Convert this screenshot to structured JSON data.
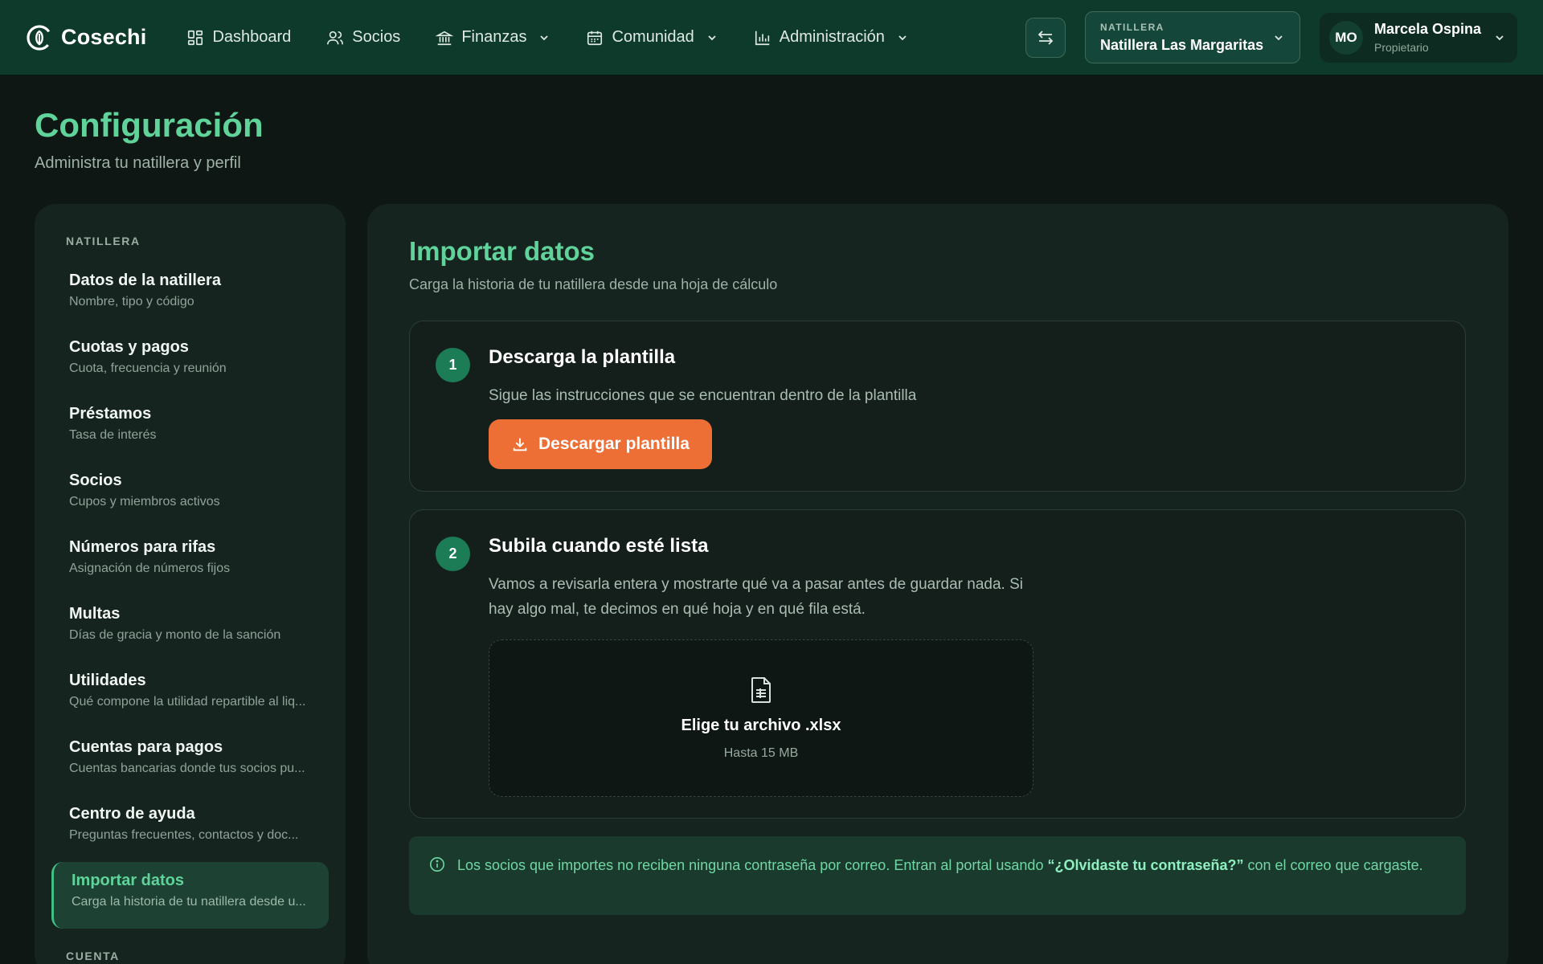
{
  "brand": {
    "name": "Cosechi"
  },
  "nav": {
    "items": [
      {
        "label": "Dashboard",
        "icon": "dashboard-icon"
      },
      {
        "label": "Socios",
        "icon": "users-icon"
      },
      {
        "label": "Finanzas",
        "icon": "bank-icon"
      },
      {
        "label": "Comunidad",
        "icon": "calendar-icon"
      },
      {
        "label": "Administración",
        "icon": "chart-icon"
      }
    ]
  },
  "org": {
    "label": "NATILLERA",
    "name": "Natillera Las Margaritas"
  },
  "user": {
    "initials": "MO",
    "name": "Marcela Ospina",
    "role": "Propietario"
  },
  "page": {
    "title": "Configuración",
    "subtitle": "Administra tu natillera y perfil"
  },
  "sidebar": {
    "section1": "NATILLERA",
    "section2": "CUENTA",
    "items": [
      {
        "title": "Datos de la natillera",
        "desc": "Nombre, tipo y código"
      },
      {
        "title": "Cuotas y pagos",
        "desc": "Cuota, frecuencia y reunión"
      },
      {
        "title": "Préstamos",
        "desc": "Tasa de interés"
      },
      {
        "title": "Socios",
        "desc": "Cupos y miembros activos"
      },
      {
        "title": "Números para rifas",
        "desc": "Asignación de números fijos"
      },
      {
        "title": "Multas",
        "desc": "Días de gracia y monto de la sanción"
      },
      {
        "title": "Utilidades",
        "desc": "Qué compone la utilidad repartible al liq..."
      },
      {
        "title": "Cuentas para pagos",
        "desc": "Cuentas bancarias donde tus socios pu..."
      },
      {
        "title": "Centro de ayuda",
        "desc": "Preguntas frecuentes, contactos y doc..."
      },
      {
        "title": "Importar datos",
        "desc": "Carga la historia de tu natillera desde u..."
      }
    ]
  },
  "main": {
    "title": "Importar datos",
    "subtitle": "Carga la historia de tu natillera desde una hoja de cálculo",
    "step1": {
      "number": "1",
      "title": "Descarga la plantilla",
      "desc": "Sigue las instrucciones que se encuentran dentro de la plantilla",
      "button": "Descargar plantilla"
    },
    "step2": {
      "number": "2",
      "title": "Subila cuando esté lista",
      "desc": "Vamos a revisarla entera y mostrarte qué va a pasar antes de guardar nada. Si hay algo mal, te decimos en qué hoja y en qué fila está.",
      "dropzone_title": "Elige tu archivo .xlsx",
      "dropzone_sub": "Hasta 15 MB"
    },
    "note": {
      "before": "Los socios que importes no reciben ninguna contraseña por correo. Entran al portal usando ",
      "bold": "“¿Olvidaste tu contraseña?”",
      "after": " con el correo que cargaste."
    }
  },
  "colors": {
    "topbar": "#0d3a2b",
    "accent": "#5fd39a",
    "button_orange": "#ee6f35",
    "panel": "#162420",
    "background": "#0f1714"
  }
}
